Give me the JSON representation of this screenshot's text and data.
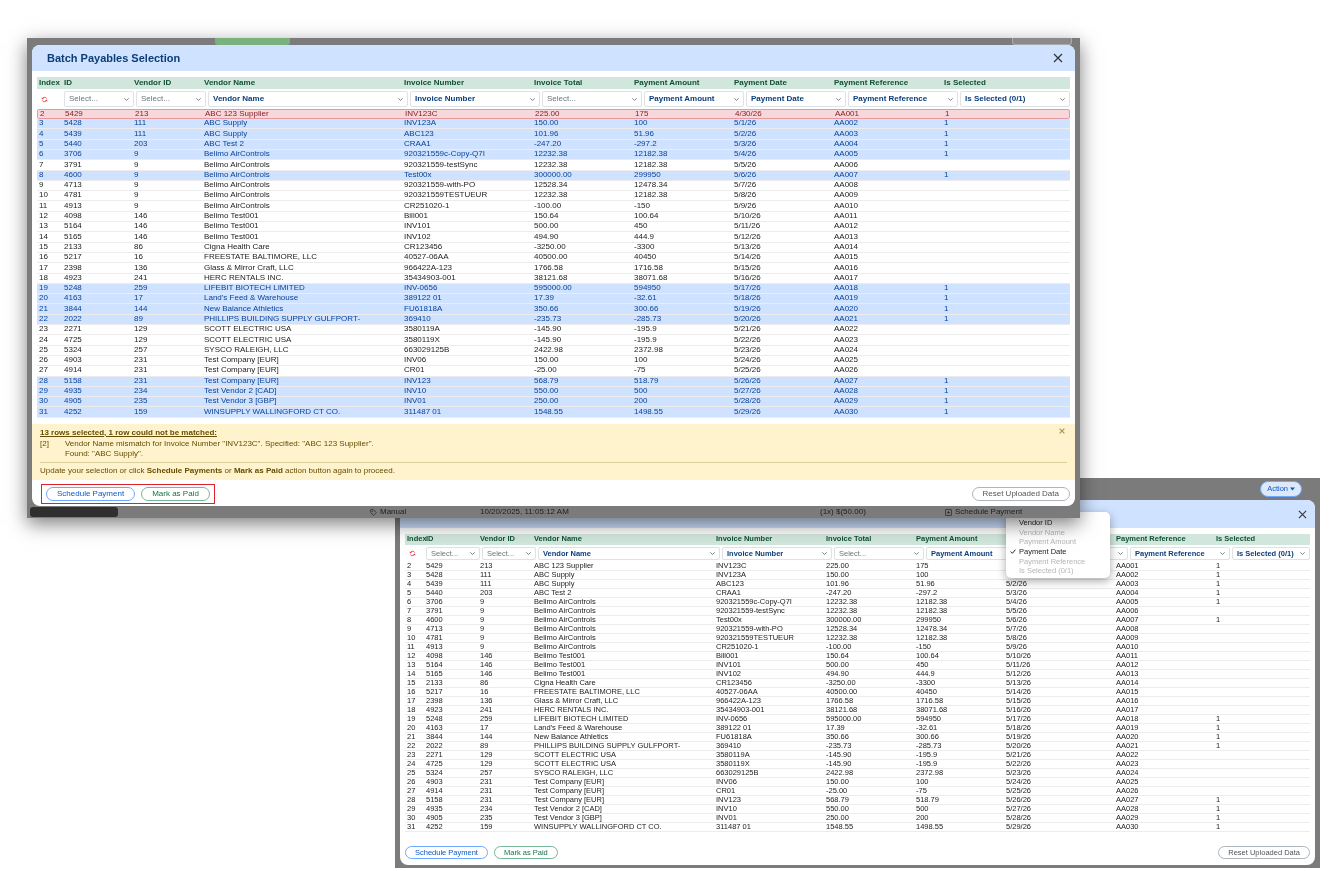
{
  "screenshot_1": {
    "modal": {
      "title": "Batch Payables Selection",
      "columns": [
        "Index",
        "ID",
        "Vendor ID",
        "Vendor Name",
        "Invoice Number",
        "Invoice Total",
        "Payment Amount",
        "Payment Date",
        "Payment Reference",
        "Is Selected"
      ],
      "filters": [
        {
          "kind": "reset"
        },
        {
          "kind": "select",
          "placeholder": "Select..."
        },
        {
          "kind": "select",
          "placeholder": "Select..."
        },
        {
          "kind": "select",
          "value": "Vendor Name"
        },
        {
          "kind": "select",
          "value": "Invoice Number"
        },
        {
          "kind": "select",
          "placeholder": "Select..."
        },
        {
          "kind": "select",
          "value": "Payment Amount"
        },
        {
          "kind": "select",
          "value": "Payment Date"
        },
        {
          "kind": "select",
          "value": "Payment Reference"
        },
        {
          "kind": "select",
          "value": "Is Selected (0/1)"
        }
      ],
      "rows": [
        {
          "cells": [
            "2",
            "5429",
            "213",
            "ABC 123 Supplier",
            "INV123C",
            "225.00",
            "175",
            "4/30/26",
            "AA001",
            "1"
          ],
          "selected": false,
          "mismatch": true
        },
        {
          "cells": [
            "3",
            "5428",
            "111",
            "ABC Supply",
            "INV123A",
            "150.00",
            "100",
            "5/1/26",
            "AA002",
            "1"
          ],
          "selected": true,
          "mismatch": false
        },
        {
          "cells": [
            "4",
            "5439",
            "111",
            "ABC Supply",
            "ABC123",
            "101.96",
            "51.96",
            "5/2/26",
            "AA003",
            "1"
          ],
          "selected": true,
          "mismatch": false
        },
        {
          "cells": [
            "5",
            "5440",
            "203",
            "ABC Test 2",
            "CRAA1",
            "-247.20",
            "-297.2",
            "5/3/26",
            "AA004",
            "1"
          ],
          "selected": true,
          "mismatch": false
        },
        {
          "cells": [
            "6",
            "3706",
            "9",
            "Belimo AirControls",
            "920321559c-Copy-Q7I",
            "12232.38",
            "12182.38",
            "5/4/26",
            "AA005",
            "1"
          ],
          "selected": true,
          "mismatch": false
        },
        {
          "cells": [
            "7",
            "3791",
            "9",
            "Belimo AirControls",
            "920321559-testSync",
            "12232.38",
            "12182.38",
            "5/5/26",
            "AA006",
            null
          ],
          "selected": false,
          "mismatch": false
        },
        {
          "cells": [
            "8",
            "4600",
            "9",
            "Belimo AirControls",
            "Test00x",
            "300000.00",
            "299950",
            "5/6/26",
            "AA007",
            "1"
          ],
          "selected": true,
          "mismatch": false
        },
        {
          "cells": [
            "9",
            "4713",
            "9",
            "Belimo AirControls",
            "920321559-with-PO",
            "12528.34",
            "12478.34",
            "5/7/26",
            "AA008",
            null
          ],
          "selected": false,
          "mismatch": false
        },
        {
          "cells": [
            "10",
            "4781",
            "9",
            "Belimo AirControls",
            "920321559TESTUEUR",
            "12232.38",
            "12182.38",
            "5/8/26",
            "AA009",
            null
          ],
          "selected": false,
          "mismatch": false
        },
        {
          "cells": [
            "11",
            "4913",
            "9",
            "Belimo AirControls",
            "CR251020-1",
            "-100.00",
            "-150",
            "5/9/26",
            "AA010",
            null
          ],
          "selected": false,
          "mismatch": false
        },
        {
          "cells": [
            "12",
            "4098",
            "146",
            "Belimo Test001",
            "Bill001",
            "150.64",
            "100.64",
            "5/10/26",
            "AA011",
            null
          ],
          "selected": false,
          "mismatch": false
        },
        {
          "cells": [
            "13",
            "5164",
            "146",
            "Belimo Test001",
            "INV101",
            "500.00",
            "450",
            "5/11/26",
            "AA012",
            null
          ],
          "selected": false,
          "mismatch": false
        },
        {
          "cells": [
            "14",
            "5165",
            "146",
            "Belimo Test001",
            "INV102",
            "494.90",
            "444.9",
            "5/12/26",
            "AA013",
            null
          ],
          "selected": false,
          "mismatch": false
        },
        {
          "cells": [
            "15",
            "2133",
            "86",
            "Cigna Health Care",
            "CR123456",
            "-3250.00",
            "-3300",
            "5/13/26",
            "AA014",
            null
          ],
          "selected": false,
          "mismatch": false
        },
        {
          "cells": [
            "16",
            "5217",
            "16",
            "FREESTATE BALTIMORE, LLC",
            "40527-06AA",
            "40500.00",
            "40450",
            "5/14/26",
            "AA015",
            null
          ],
          "selected": false,
          "mismatch": false
        },
        {
          "cells": [
            "17",
            "2398",
            "136",
            "Glass & Mirror Craft, LLC",
            "966422A-123",
            "1766.58",
            "1716.58",
            "5/15/26",
            "AA016",
            null
          ],
          "selected": false,
          "mismatch": false
        },
        {
          "cells": [
            "18",
            "4923",
            "241",
            "HERC RENTALS INC.",
            "35434903-001",
            "38121.68",
            "38071.68",
            "5/16/26",
            "AA017",
            null
          ],
          "selected": false,
          "mismatch": false
        },
        {
          "cells": [
            "19",
            "5248",
            "259",
            "LIFEBIT BIOTECH LIMITED",
            "INV-0656",
            "595000.00",
            "594950",
            "5/17/26",
            "AA018",
            "1"
          ],
          "selected": true,
          "mismatch": false
        },
        {
          "cells": [
            "20",
            "4163",
            "17",
            "Land's Feed & Warehouse",
            "389122 01",
            "17.39",
            "-32.61",
            "5/18/26",
            "AA019",
            "1"
          ],
          "selected": true,
          "mismatch": false
        },
        {
          "cells": [
            "21",
            "3844",
            "144",
            "New Balance Athletics",
            "FU61818A",
            "350.66",
            "300.66",
            "5/19/26",
            "AA020",
            "1"
          ],
          "selected": true,
          "mismatch": false
        },
        {
          "cells": [
            "22",
            "2022",
            "89",
            "PHILLIPS BUILDING SUPPLY GULFPORT-",
            "369410",
            "-235.73",
            "-285.73",
            "5/20/26",
            "AA021",
            "1"
          ],
          "selected": true,
          "mismatch": false
        },
        {
          "cells": [
            "23",
            "2271",
            "129",
            "SCOTT ELECTRIC USA",
            "3580119A",
            "-145.90",
            "-195.9",
            "5/21/26",
            "AA022",
            null
          ],
          "selected": false,
          "mismatch": false
        },
        {
          "cells": [
            "24",
            "4725",
            "129",
            "SCOTT ELECTRIC USA",
            "3580119X",
            "-145.90",
            "-195.9",
            "5/22/26",
            "AA023",
            null
          ],
          "selected": false,
          "mismatch": false
        },
        {
          "cells": [
            "25",
            "5324",
            "257",
            "SYSCO RALEIGH, LLC",
            "663029125B",
            "2422.98",
            "2372.98",
            "5/23/26",
            "AA024",
            null
          ],
          "selected": false,
          "mismatch": false
        },
        {
          "cells": [
            "26",
            "4903",
            "231",
            "Test Company [EUR]",
            "INV06",
            "150.00",
            "100",
            "5/24/26",
            "AA025",
            null
          ],
          "selected": false,
          "mismatch": false
        },
        {
          "cells": [
            "27",
            "4914",
            "231",
            "Test Company [EUR]",
            "CR01",
            "-25.00",
            "-75",
            "5/25/26",
            "AA026",
            null
          ],
          "selected": false,
          "mismatch": false
        },
        {
          "cells": [
            "28",
            "5158",
            "231",
            "Test Company [EUR]",
            "INV123",
            "568.79",
            "518.79",
            "5/26/26",
            "AA027",
            "1"
          ],
          "selected": true,
          "mismatch": false
        },
        {
          "cells": [
            "29",
            "4935",
            "234",
            "Test Vendor 2 [CAD]",
            "INV10",
            "550.00",
            "500",
            "5/27/26",
            "AA028",
            "1"
          ],
          "selected": true,
          "mismatch": false
        },
        {
          "cells": [
            "30",
            "4905",
            "235",
            "Test Vendor 3 [GBP]",
            "INV01",
            "250.00",
            "200",
            "5/28/26",
            "AA029",
            "1"
          ],
          "selected": true,
          "mismatch": false
        },
        {
          "cells": [
            "31",
            "4252",
            "159",
            "WINSUPPLY WALLINGFORD CT CO.",
            "311487 01",
            "1548.55",
            "1498.55",
            "5/29/26",
            "AA030",
            "1"
          ],
          "selected": true,
          "mismatch": false
        }
      ],
      "alert": {
        "summary": "13 rows selected, 1 row could not be matched:",
        "messages": [
          {
            "ref": "[2]",
            "text": "Vendor Name mismatch for Invoice Number \"INV123C\". Specified: \"ABC 123 Supplier\". Found: \"ABC Supply\"."
          }
        ],
        "instruction": "Update your selection or click **Schedule Payments** or **Mark as Paid** action button again to proceed."
      },
      "buttons": [
        {
          "label": "Schedule Payment",
          "kind": "primary",
          "highlighted": true
        },
        {
          "label": "Mark as Paid",
          "kind": "success",
          "highlighted": true
        },
        {
          "label": "Reset Uploaded Data",
          "kind": "secondary",
          "highlighted": false
        }
      ]
    },
    "background_page": [
      {
        "kind": "tag",
        "text": "Manual"
      },
      {
        "kind": "text",
        "text": "10/20/2025, 11:05:12 AM"
      },
      {
        "kind": "text",
        "text": "(1x) $(50.00)"
      },
      {
        "kind": "action",
        "text": "Schedule Payment"
      }
    ]
  },
  "screenshot_2": {
    "action_button": "Action",
    "column_menu": [
      {
        "label": "Vendor ID",
        "checked": false,
        "disabled": false
      },
      {
        "label": "Vendor Name",
        "checked": false,
        "disabled": true
      },
      {
        "label": "Payment Amount",
        "checked": false,
        "disabled": true
      },
      {
        "label": "Payment Date",
        "checked": true,
        "disabled": false
      },
      {
        "label": "Payment Reference",
        "checked": false,
        "disabled": true
      },
      {
        "label": "Is Selected (0/1)",
        "checked": false,
        "disabled": true
      }
    ],
    "modal": {
      "columns": [
        "Index",
        "ID",
        "Vendor ID",
        "Vendor Name",
        "Invoice Number",
        "Invoice Total",
        "Payment Amount",
        null,
        "Payment Reference",
        "Is Selected"
      ],
      "filters": [
        {
          "kind": "reset"
        },
        {
          "kind": "select",
          "placeholder": "Select..."
        },
        {
          "kind": "select",
          "placeholder": "Select..."
        },
        {
          "kind": "select",
          "value": "Vendor Name"
        },
        {
          "kind": "select",
          "value": "Invoice Number"
        },
        {
          "kind": "select",
          "placeholder": "Select..."
        },
        {
          "kind": "select",
          "value": "Payment Amount"
        },
        {
          "kind": "select"
        },
        {
          "kind": "select",
          "value": "Payment Reference"
        },
        {
          "kind": "select",
          "value": "Is Selected (0/1)"
        }
      ],
      "rows": [
        {
          "cells": [
            "2",
            "5429",
            "213",
            "ABC 123 Supplier",
            "INV123C",
            "225.00",
            "175",
            null,
            "AA001",
            "1"
          ],
          "selected": false
        },
        {
          "cells": [
            "3",
            "5428",
            "111",
            "ABC Supply",
            "INV123A",
            "150.00",
            "100",
            null,
            "AA002",
            "1"
          ],
          "selected": false
        },
        {
          "cells": [
            "4",
            "5439",
            "111",
            "ABC Supply",
            "ABC123",
            "101.96",
            "51.96",
            "5/2/26",
            "AA003",
            "1"
          ],
          "selected": false
        },
        {
          "cells": [
            "5",
            "5440",
            "203",
            "ABC Test 2",
            "CRAA1",
            "-247.20",
            "-297.2",
            "5/3/26",
            "AA004",
            "1"
          ],
          "selected": false
        },
        {
          "cells": [
            "6",
            "3706",
            "9",
            "Belimo AirControls",
            "920321559c-Copy-Q7I",
            "12232.38",
            "12182.38",
            "5/4/26",
            "AA005",
            "1"
          ],
          "selected": false
        },
        {
          "cells": [
            "7",
            "3791",
            "9",
            "Belimo AirControls",
            "920321559-testSync",
            "12232.38",
            "12182.38",
            "5/5/26",
            "AA006",
            null
          ],
          "selected": false
        },
        {
          "cells": [
            "8",
            "4600",
            "9",
            "Belimo AirControls",
            "Test00x",
            "300000.00",
            "299950",
            "5/6/26",
            "AA007",
            "1"
          ],
          "selected": false
        },
        {
          "cells": [
            "9",
            "4713",
            "9",
            "Belimo AirControls",
            "920321559-with-PO",
            "12528.34",
            "12478.34",
            "5/7/26",
            "AA008",
            null
          ],
          "selected": false
        },
        {
          "cells": [
            "10",
            "4781",
            "9",
            "Belimo AirControls",
            "920321559TESTUEUR",
            "12232.38",
            "12182.38",
            "5/8/26",
            "AA009",
            null
          ],
          "selected": false
        },
        {
          "cells": [
            "11",
            "4913",
            "9",
            "Belimo AirControls",
            "CR251020-1",
            "-100.00",
            "-150",
            "5/9/26",
            "AA010",
            null
          ],
          "selected": false
        },
        {
          "cells": [
            "12",
            "4098",
            "146",
            "Belimo Test001",
            "Bill001",
            "150.64",
            "100.64",
            "5/10/26",
            "AA011",
            null
          ],
          "selected": false
        },
        {
          "cells": [
            "13",
            "5164",
            "146",
            "Belimo Test001",
            "INV101",
            "500.00",
            "450",
            "5/11/26",
            "AA012",
            null
          ],
          "selected": false
        },
        {
          "cells": [
            "14",
            "5165",
            "146",
            "Belimo Test001",
            "INV102",
            "494.90",
            "444.9",
            "5/12/26",
            "AA013",
            null
          ],
          "selected": false
        },
        {
          "cells": [
            "15",
            "2133",
            "86",
            "Cigna Health Care",
            "CR123456",
            "-3250.00",
            "-3300",
            "5/13/26",
            "AA014",
            null
          ],
          "selected": false
        },
        {
          "cells": [
            "16",
            "5217",
            "16",
            "FREESTATE BALTIMORE, LLC",
            "40527-06AA",
            "40500.00",
            "40450",
            "5/14/26",
            "AA015",
            null
          ],
          "selected": false
        },
        {
          "cells": [
            "17",
            "2398",
            "136",
            "Glass & Mirror Craft, LLC",
            "966422A-123",
            "1766.58",
            "1716.58",
            "5/15/26",
            "AA016",
            null
          ],
          "selected": false
        },
        {
          "cells": [
            "18",
            "4923",
            "241",
            "HERC RENTALS INC.",
            "35434903-001",
            "38121.68",
            "38071.68",
            "5/16/26",
            "AA017",
            null
          ],
          "selected": false
        },
        {
          "cells": [
            "19",
            "5248",
            "259",
            "LIFEBIT BIOTECH LIMITED",
            "INV-0656",
            "595000.00",
            "594950",
            "5/17/26",
            "AA018",
            "1"
          ],
          "selected": false
        },
        {
          "cells": [
            "20",
            "4163",
            "17",
            "Land's Feed & Warehouse",
            "389122 01",
            "17.39",
            "-32.61",
            "5/18/26",
            "AA019",
            "1"
          ],
          "selected": false
        },
        {
          "cells": [
            "21",
            "3844",
            "144",
            "New Balance Athletics",
            "FU61818A",
            "350.66",
            "300.66",
            "5/19/26",
            "AA020",
            "1"
          ],
          "selected": false
        },
        {
          "cells": [
            "22",
            "2022",
            "89",
            "PHILLIPS BUILDING SUPPLY GULFPORT-",
            "369410",
            "-235.73",
            "-285.73",
            "5/20/26",
            "AA021",
            "1"
          ],
          "selected": false
        },
        {
          "cells": [
            "23",
            "2271",
            "129",
            "SCOTT ELECTRIC USA",
            "3580119A",
            "-145.90",
            "-195.9",
            "5/21/26",
            "AA022",
            null
          ],
          "selected": false
        },
        {
          "cells": [
            "24",
            "4725",
            "129",
            "SCOTT ELECTRIC USA",
            "3580119X",
            "-145.90",
            "-195.9",
            "5/22/26",
            "AA023",
            null
          ],
          "selected": false
        },
        {
          "cells": [
            "25",
            "5324",
            "257",
            "SYSCO RALEIGH, LLC",
            "663029125B",
            "2422.98",
            "2372.98",
            "5/23/26",
            "AA024",
            null
          ],
          "selected": false
        },
        {
          "cells": [
            "26",
            "4903",
            "231",
            "Test Company [EUR]",
            "INV06",
            "150.00",
            "100",
            "5/24/26",
            "AA025",
            null
          ],
          "selected": false
        },
        {
          "cells": [
            "27",
            "4914",
            "231",
            "Test Company [EUR]",
            "CR01",
            "-25.00",
            "-75",
            "5/25/26",
            "AA026",
            null
          ],
          "selected": false
        },
        {
          "cells": [
            "28",
            "5158",
            "231",
            "Test Company [EUR]",
            "INV123",
            "568.79",
            "518.79",
            "5/26/26",
            "AA027",
            "1"
          ],
          "selected": false
        },
        {
          "cells": [
            "29",
            "4935",
            "234",
            "Test Vendor 2 [CAD]",
            "INV10",
            "550.00",
            "500",
            "5/27/26",
            "AA028",
            "1"
          ],
          "selected": false
        },
        {
          "cells": [
            "30",
            "4905",
            "235",
            "Test Vendor 3 [GBP]",
            "INV01",
            "250.00",
            "200",
            "5/28/26",
            "AA029",
            "1"
          ],
          "selected": false
        },
        {
          "cells": [
            "31",
            "4252",
            "159",
            "WINSUPPLY WALLINGFORD CT CO.",
            "311487 01",
            "1548.55",
            "1498.55",
            "5/29/26",
            "AA030",
            "1"
          ],
          "selected": false
        }
      ],
      "buttons": [
        {
          "label": "Schedule Payment",
          "kind": "primary",
          "highlighted": false
        },
        {
          "label": "Mark as Paid",
          "kind": "success",
          "highlighted": false
        },
        {
          "label": "Reset Uploaded Data",
          "kind": "secondary",
          "highlighted": false
        }
      ]
    }
  }
}
